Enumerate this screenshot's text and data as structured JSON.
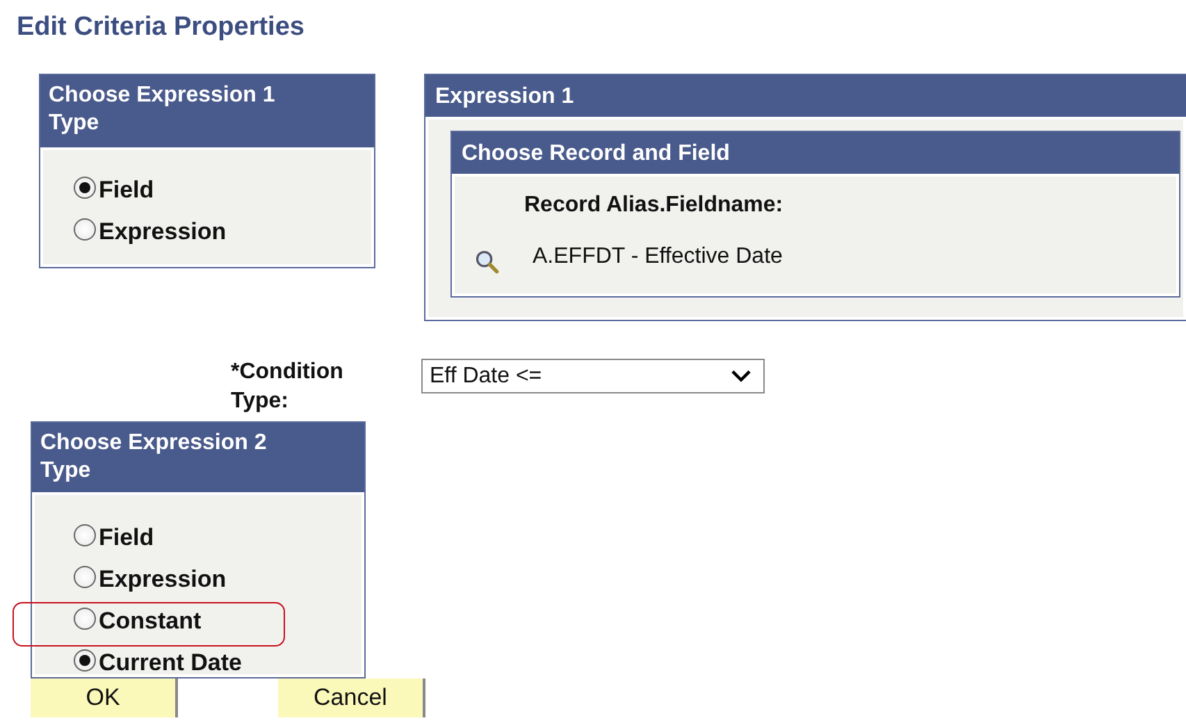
{
  "title": "Edit Criteria Properties",
  "expression1_type": {
    "title": "Choose Expression 1 Type",
    "options": [
      {
        "label": "Field",
        "selected": true,
        "highlighted": false
      },
      {
        "label": "Expression",
        "selected": false,
        "highlighted": false
      }
    ]
  },
  "expression1": {
    "title": "Expression 1",
    "record_field": {
      "title": "Choose Record and Field",
      "label": "Record Alias.Fieldname:",
      "value": "A.EFFDT - Effective Date"
    }
  },
  "condition_type": {
    "label": "*Condition Type:",
    "value": "Eff Date <="
  },
  "expression2_type": {
    "title": "Choose Expression 2 Type",
    "options": [
      {
        "label": "Field",
        "selected": false,
        "highlighted": false
      },
      {
        "label": "Expression",
        "selected": false,
        "highlighted": false
      },
      {
        "label": "Constant",
        "selected": false,
        "highlighted": true
      },
      {
        "label": "Current Date",
        "selected": true,
        "highlighted": false
      }
    ]
  },
  "buttons": [
    "OK",
    "Cancel"
  ]
}
